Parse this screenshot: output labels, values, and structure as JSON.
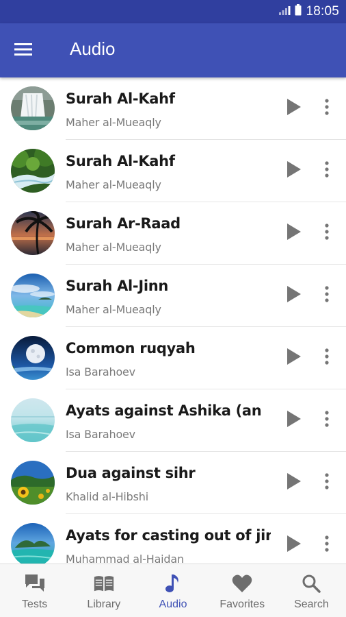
{
  "status_bar": {
    "time": "18:05",
    "icons": [
      "signal-icon",
      "battery-icon"
    ]
  },
  "app_bar": {
    "title": "Audio",
    "menu_icon": "hamburger-menu-icon"
  },
  "colors": {
    "primary": "#3f51b5",
    "primary_dark": "#303f9f",
    "title_text": "#1a1a1a",
    "subtitle_text": "#7a7a7a",
    "icon_gray": "#757575",
    "active_nav": "#3f51b5"
  },
  "tracks": [
    {
      "title": "Surah Al-Kahf",
      "reciter": "Maher al-Mueaqly",
      "thumbnail": "waterfall"
    },
    {
      "title": "Surah Al-Kahf",
      "reciter": "Maher al-Mueaqly",
      "thumbnail": "forest-stream"
    },
    {
      "title": "Surah Ar-Raad",
      "reciter": "Maher al-Mueaqly",
      "thumbnail": "palm-sunset"
    },
    {
      "title": "Surah Al-Jinn",
      "reciter": "Maher al-Mueaqly",
      "thumbnail": "tropical-sky"
    },
    {
      "title": "Common ruqyah",
      "reciter": "Isa Barahoev",
      "thumbnail": "moon-night"
    },
    {
      "title": "Ayats against Ashika (an",
      "reciter": "Isa Barahoev",
      "thumbnail": "calm-sea"
    },
    {
      "title": "Dua against sihr",
      "reciter": "Khalid al-Hibshi",
      "thumbnail": "sunflower-field"
    },
    {
      "title": "Ayats for casting out of jinn",
      "reciter": "Muhammad al-Haidan",
      "thumbnail": "island-lagoon"
    }
  ],
  "row_actions": {
    "play_icon": "play-icon",
    "more_icon": "more-vert-icon"
  },
  "bottom_nav": {
    "active": "Audio",
    "items": [
      {
        "label": "Tests",
        "icon": "chat-bubbles-icon"
      },
      {
        "label": "Library",
        "icon": "open-book-icon"
      },
      {
        "label": "Audio",
        "icon": "music-note-icon"
      },
      {
        "label": "Favorites",
        "icon": "heart-icon"
      },
      {
        "label": "Search",
        "icon": "search-icon"
      }
    ]
  }
}
